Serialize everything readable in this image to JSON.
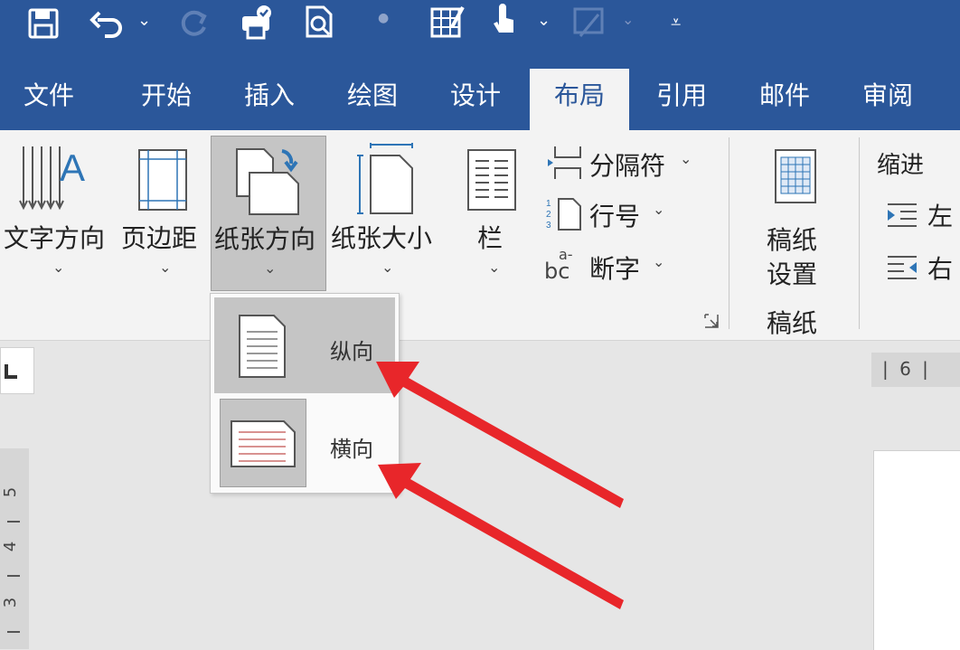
{
  "tabs": [
    {
      "label": "文件",
      "left": 0
    },
    {
      "label": "开始"
    },
    {
      "label": "插入"
    },
    {
      "label": "绘图"
    },
    {
      "label": "设计"
    },
    {
      "label": "布局"
    },
    {
      "label": "引用"
    },
    {
      "label": "邮件"
    },
    {
      "label": "审阅"
    }
  ],
  "ribbon": {
    "text_direction": "文字方向",
    "margins": "页边距",
    "orientation": "纸张方向",
    "size": "纸张大小",
    "columns": "栏",
    "breaks": "分隔符",
    "line_numbers": "行号",
    "hyphenation": "断字",
    "draft_paper_setup_line1": "稿纸",
    "draft_paper_setup_line2": "设置",
    "draft_group": "稿纸",
    "indent_group": "缩进",
    "indent_left": "左",
    "indent_right": "右",
    "hyphen_glyph": "bc",
    "hyphen_glyph_sup": "a-"
  },
  "orientation_menu": {
    "portrait": "纵向",
    "landscape": "横向"
  },
  "ruler": {
    "horizontal_mark": "| 6 |",
    "vertical_marks": [
      "5",
      "4",
      "3"
    ]
  },
  "colors": {
    "accent": "#2b579a",
    "arrow": "#e8262a"
  }
}
